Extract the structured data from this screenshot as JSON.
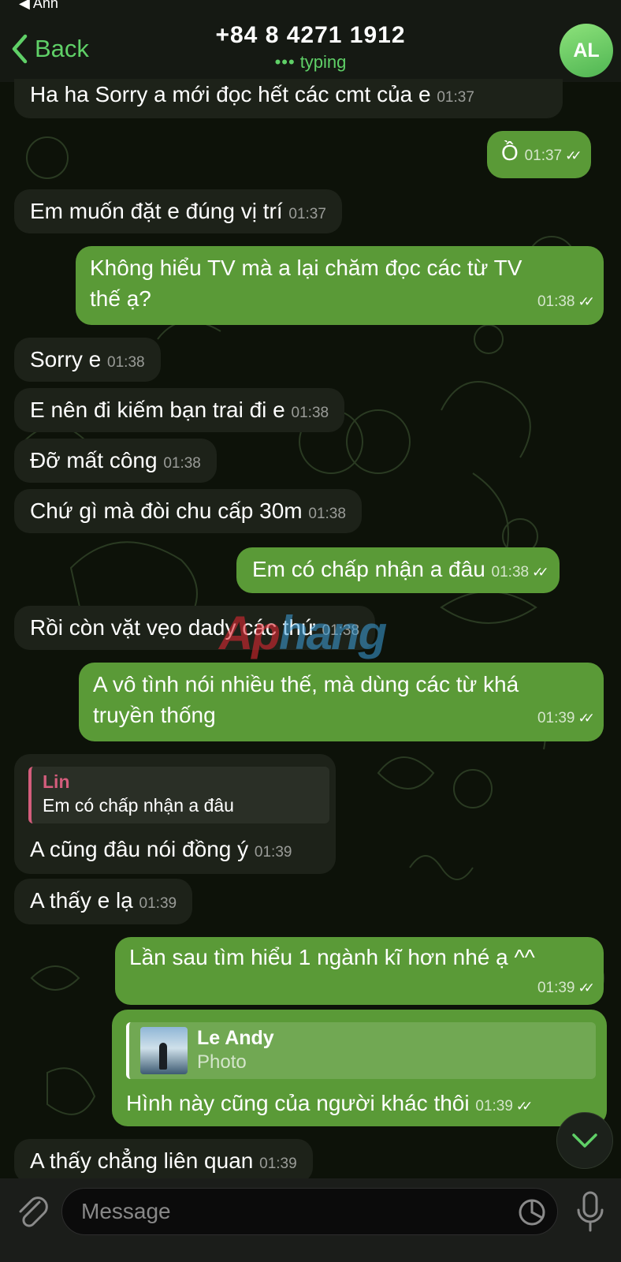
{
  "header": {
    "status_back": "◀ Anh",
    "back_label": "Back",
    "title": "+84 8 4271 1912",
    "subtitle": "typing",
    "typing_dots": "•••",
    "avatar_initials": "AL"
  },
  "messages": [
    {
      "dir": "in",
      "text": "Ha ha Sorry a mới đọc hết các cmt của e",
      "time": "01:37"
    },
    {
      "dir": "out",
      "text": "Ồ",
      "time": "01:37"
    },
    {
      "dir": "in",
      "text": "Em muốn đặt e đúng vị trí",
      "time": "01:37"
    },
    {
      "dir": "out",
      "text": "Không hiểu TV mà a lại chăm đọc các từ TV",
      "text2": "thế ạ?",
      "time": "01:38"
    },
    {
      "dir": "in",
      "text": "Sorry e",
      "time": "01:38"
    },
    {
      "dir": "in",
      "text": "E nên đi kiếm bạn trai đi e",
      "time": "01:38"
    },
    {
      "dir": "in",
      "text": "Đỡ mất công",
      "time": "01:38"
    },
    {
      "dir": "in",
      "text": "Chứ gì mà đòi chu cấp 30m",
      "time": "01:38"
    },
    {
      "dir": "out",
      "text": "Em có chấp nhận a đâu",
      "time": "01:38"
    },
    {
      "dir": "in",
      "text": "Rồi còn vặt vẹo dady các thứ",
      "time": "01:38"
    },
    {
      "dir": "out",
      "text": "A vô tình nói nhiều thế, mà dùng các từ khá",
      "text2": "truyền thống",
      "time": "01:39"
    },
    {
      "dir": "in",
      "reply_name": "Lin",
      "reply_text": "Em có chấp nhận a đâu",
      "text": "A cũng đâu nói đồng ý",
      "time": "01:39"
    },
    {
      "dir": "in",
      "text": "A thấy e lạ",
      "time": "01:39"
    },
    {
      "dir": "out",
      "text": "Lần sau tìm hiểu 1 ngành kĩ hơn nhé ạ ^^",
      "time": "01:39"
    },
    {
      "dir": "out",
      "reply_name": "Le Andy",
      "reply_text": "Photo",
      "text": "Hình này cũng của người khác thôi",
      "time": "01:39"
    },
    {
      "dir": "in",
      "text": "A thấy chẳng liên quan",
      "time": "01:39"
    }
  ],
  "watermark": {
    "part1": "Ap",
    "part2": "hang"
  },
  "composer": {
    "placeholder": "Message"
  },
  "colors": {
    "accent": "#5fd067",
    "outgoing_bubble": "#5a9a37",
    "incoming_bubble": "#1d2219",
    "reply_bar": "#d45d7c"
  },
  "icons": [
    "chevron-left-icon",
    "attach-icon",
    "sticker-icon",
    "microphone-icon",
    "chevron-down-icon",
    "double-check-icon"
  ]
}
